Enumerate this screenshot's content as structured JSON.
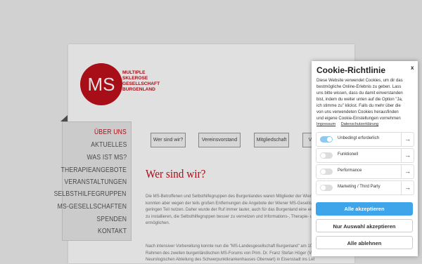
{
  "logo": {
    "abbr": "MS",
    "lines": [
      "Multiple",
      "Sklerose",
      "Gesellschaft",
      "Burgenland"
    ]
  },
  "nav": {
    "items": [
      {
        "label": "ÜBER UNS",
        "active": true
      },
      {
        "label": "AKTUELLES"
      },
      {
        "label": "WAS IST MS?"
      },
      {
        "label": "THERAPIEANGEBOTE"
      },
      {
        "label": "VERANSTALTUNGEN"
      },
      {
        "label": "SELBSTHILFEGRUPPEN"
      },
      {
        "label": "MS-GESELLSCHAFTEN"
      },
      {
        "label": "SPENDEN"
      },
      {
        "label": "KONTAKT"
      }
    ]
  },
  "tabs": [
    "Wer sind wir?",
    "Vereinsvorstand",
    "Mitgliedschaft",
    "V"
  ],
  "content": {
    "heading": "Wer sind wir?",
    "para1": [
      "Die MS-Betroffenen und Selbsthilfegruppen des Burgenlandes waren Mitglieder der Wiener",
      "konnten aber wegen der teils großen Entfernungen die Angebote der Wiener MS-Gesellschaft",
      "geringen Teil nutzen. Daher wurde der Ruf immer lauter, auch für das Burgenland eine eigene",
      "zu installieren, die Selbsthilfegruppen besser zu vernetzen und Informations-, Therapie- u.ä.",
      "ermöglichen."
    ],
    "para2": [
      "Nach intensiver Vorbereitung konnte nun die \"MS-Landesgesellschaft Burgenland\" am 10. Ju",
      "Rahmen des zweiten burgenländischen MS-Forums von Prim. Dr. Franz Stefan Höger (Vorsta",
      "Neurologischen Abteilung des Schwerpunktkrankenhauses Oberwart) in Eisenstadt ins Leben gerufen"
    ]
  },
  "cookie": {
    "title": "Cookie-Richtlinie",
    "close": "x",
    "description": [
      "Diese Website verwendet Cookies, um dir das",
      "bestmögliche Online-Erlebnis zu geben. Lass",
      "uns bitte wissen, dass du damit einverstanden",
      "bist, indem du weiter unten auf die Option \"Ja,",
      "ich stimme zu\" klickst. Falls du mehr über die",
      "von uns verwendeten Cookies herausfinden",
      "und eigene Cookie-Einstellungen vornehmen"
    ],
    "links": [
      "Impressum",
      "Datenschutzerklärung"
    ],
    "options": [
      {
        "label": "Unbedingt erforderlich",
        "enabled": true
      },
      {
        "label": "Funktionell",
        "enabled": false
      },
      {
        "label": "Performance",
        "enabled": false
      },
      {
        "label": "Marketing / Third Party",
        "enabled": false
      }
    ],
    "arrow": "→",
    "buttons": {
      "accept_all": "Alle akzeptieren",
      "accept_selection": "Nur Auswahl akzeptieren",
      "reject_all": "Alle ablehnen"
    }
  },
  "colors": {
    "brand": "#c0101b",
    "accent": "#3fa5ea"
  }
}
